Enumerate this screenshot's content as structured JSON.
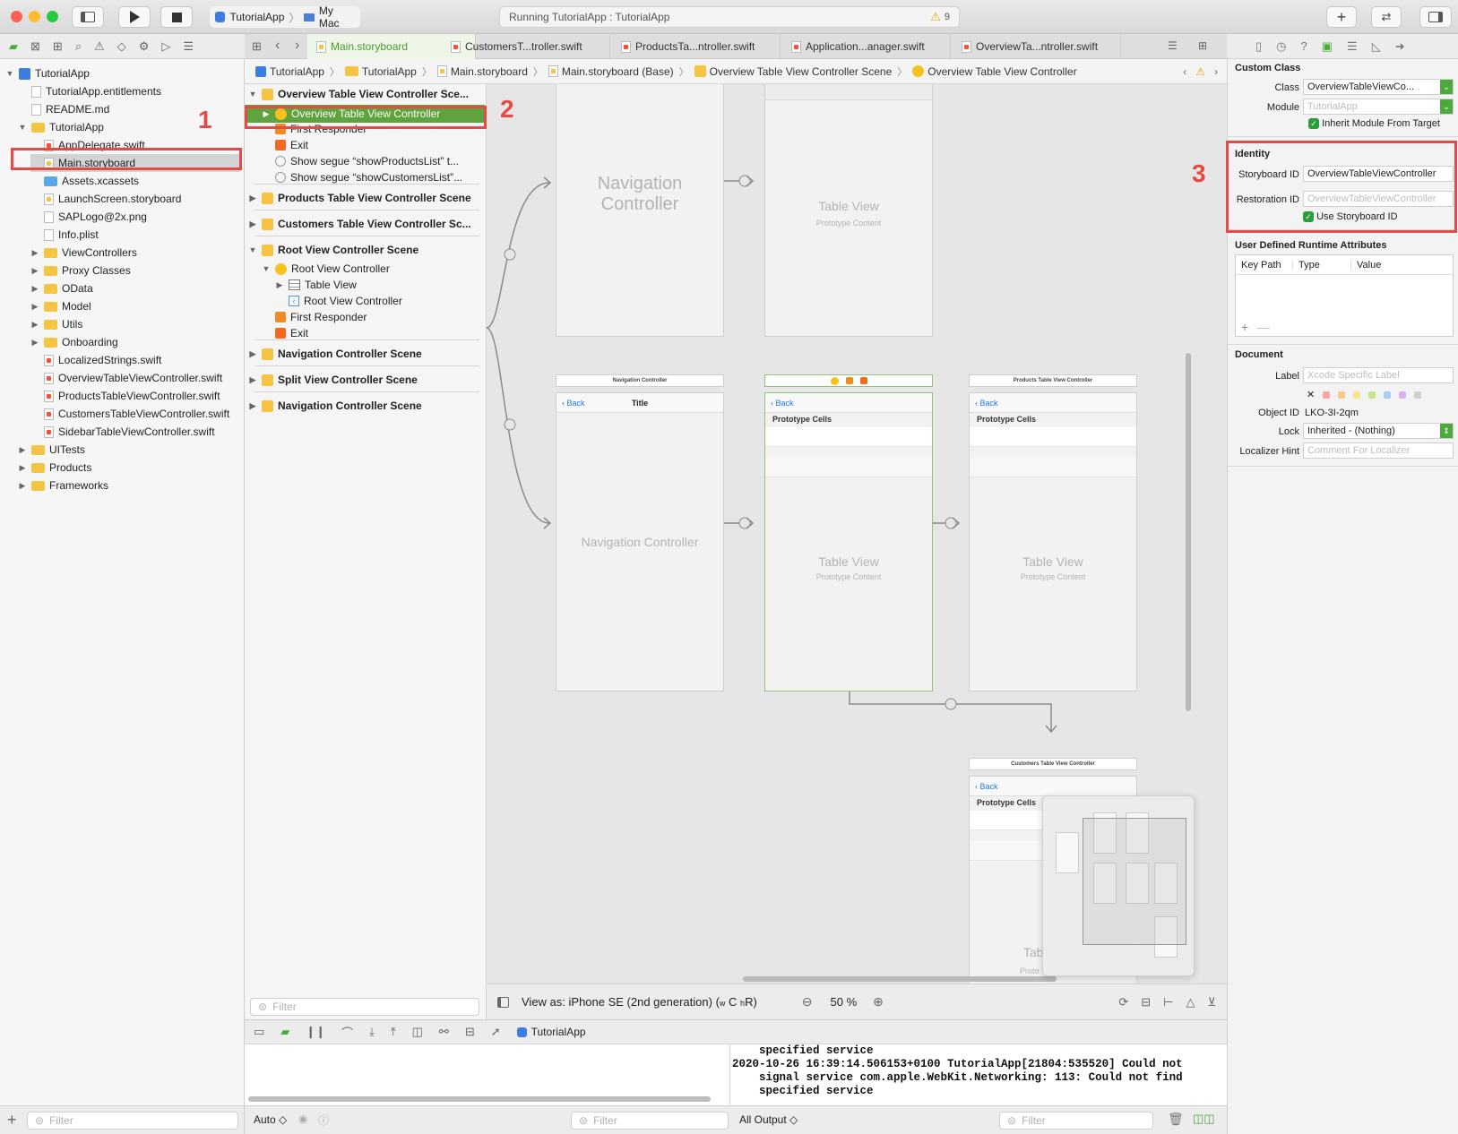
{
  "toolbar": {
    "scheme_app": "TutorialApp",
    "scheme_sep": "〉",
    "scheme_device": "My Mac",
    "status": "Running TutorialApp : TutorialApp",
    "warning_count": "9"
  },
  "navigator": {
    "items": [
      {
        "label": "TutorialApp",
        "indent": 0,
        "kind": "project",
        "disclosure": "▼"
      },
      {
        "label": "TutorialApp.entitlements",
        "indent": 1,
        "kind": "file"
      },
      {
        "label": "README.md",
        "indent": 1,
        "kind": "file"
      },
      {
        "label": "TutorialApp",
        "indent": 1,
        "kind": "folder",
        "disclosure": "▼"
      },
      {
        "label": "AppDelegate.swift",
        "indent": 2,
        "kind": "swift"
      },
      {
        "label": "Main.storyboard",
        "indent": 2,
        "kind": "storyboard",
        "selected": true
      },
      {
        "label": "Assets.xcassets",
        "indent": 2,
        "kind": "assets"
      },
      {
        "label": "LaunchScreen.storyboard",
        "indent": 2,
        "kind": "storyboard"
      },
      {
        "label": "SAPLogo@2x.png",
        "indent": 2,
        "kind": "file"
      },
      {
        "label": "Info.plist",
        "indent": 2,
        "kind": "file"
      },
      {
        "label": "ViewControllers",
        "indent": 2,
        "kind": "folder",
        "disclosure": "▶"
      },
      {
        "label": "Proxy Classes",
        "indent": 2,
        "kind": "folder",
        "disclosure": "▶"
      },
      {
        "label": "OData",
        "indent": 2,
        "kind": "folder",
        "disclosure": "▶"
      },
      {
        "label": "Model",
        "indent": 2,
        "kind": "folder",
        "disclosure": "▶"
      },
      {
        "label": "Utils",
        "indent": 2,
        "kind": "folder",
        "disclosure": "▶"
      },
      {
        "label": "Onboarding",
        "indent": 2,
        "kind": "folder",
        "disclosure": "▶"
      },
      {
        "label": "LocalizedStrings.swift",
        "indent": 2,
        "kind": "swift"
      },
      {
        "label": "OverviewTableViewController.swift",
        "indent": 2,
        "kind": "swift"
      },
      {
        "label": "ProductsTableViewController.swift",
        "indent": 2,
        "kind": "swift"
      },
      {
        "label": "CustomersTableViewController.swift",
        "indent": 2,
        "kind": "swift"
      },
      {
        "label": "SidebarTableViewController.swift",
        "indent": 2,
        "kind": "swift"
      },
      {
        "label": "UITests",
        "indent": 1,
        "kind": "folder",
        "disclosure": "▶"
      },
      {
        "label": "Products",
        "indent": 1,
        "kind": "folder",
        "disclosure": "▶"
      },
      {
        "label": "Frameworks",
        "indent": 1,
        "kind": "folder",
        "disclosure": "▶"
      }
    ],
    "filter_placeholder": "Filter"
  },
  "tabs": [
    {
      "label": "Main.storyboard",
      "active": true
    },
    {
      "label": "CustomersT...troller.swift"
    },
    {
      "label": "ProductsTa...ntroller.swift"
    },
    {
      "label": "Application...anager.swift"
    },
    {
      "label": "OverviewTa...ntroller.swift"
    }
  ],
  "breadcrumbs": [
    "TutorialApp",
    "TutorialApp",
    "Main.storyboard",
    "Main.storyboard (Base)",
    "Overview Table View Controller Scene",
    "Overview Table View Controller"
  ],
  "outline": {
    "rows": [
      {
        "label": "Overview Table View Controller Sce...",
        "indent": 0,
        "icon": "scene",
        "disclosure": "▼",
        "header": true
      },
      {
        "label": "Overview Table View Controller",
        "indent": 1,
        "icon": "vc",
        "disclosure": "▶",
        "selected": true
      },
      {
        "label": "First Responder",
        "indent": 1,
        "icon": "responder"
      },
      {
        "label": "Exit",
        "indent": 1,
        "icon": "exit"
      },
      {
        "label": "Show segue “showProductsList” t...",
        "indent": 1,
        "icon": "segue"
      },
      {
        "label": "Show segue “showCustomersList”...",
        "indent": 1,
        "icon": "segue"
      },
      {
        "label": "Products Table View Controller Scene",
        "indent": 0,
        "icon": "scene",
        "disclosure": "▶",
        "header": true
      },
      {
        "label": "Customers Table View Controller Sc...",
        "indent": 0,
        "icon": "scene",
        "disclosure": "▶",
        "header": true
      },
      {
        "label": "Root View Controller Scene",
        "indent": 0,
        "icon": "scene",
        "disclosure": "▼",
        "header": true
      },
      {
        "label": "Root View Controller",
        "indent": 1,
        "icon": "vc",
        "disclosure": "▼"
      },
      {
        "label": "Table View",
        "indent": 2,
        "icon": "table",
        "disclosure": "▶"
      },
      {
        "label": "Root View Controller",
        "indent": 2,
        "icon": "nav"
      },
      {
        "label": "First Responder",
        "indent": 1,
        "icon": "responder"
      },
      {
        "label": "Exit",
        "indent": 1,
        "icon": "exit"
      },
      {
        "label": "Navigation Controller Scene",
        "indent": 0,
        "icon": "scene",
        "disclosure": "▶",
        "header": true
      },
      {
        "label": "Split View Controller Scene",
        "indent": 0,
        "icon": "scene",
        "disclosure": "▶",
        "header": true
      },
      {
        "label": "Navigation Controller Scene",
        "indent": 0,
        "icon": "scene",
        "disclosure": "▶",
        "header": true
      }
    ],
    "filter_placeholder": "Filter"
  },
  "canvas": {
    "nav_controller_label": "Navigation Controller",
    "table_view_label": "Table View",
    "prototype_content": "Prototype Content",
    "prototype_cells": "Prototype Cells",
    "back": "Back",
    "title": "Title",
    "nav_header": "Navigation Controller",
    "products_header": "Products Table View Controller",
    "customers_header": "Customers Table View Controller",
    "partial_table": "Tab",
    "partial_proto": "Proto"
  },
  "canvas_bar": {
    "view_as": "View as: iPhone SE (2nd generation) (",
    "size_class_w": "w",
    "size_class_w_val": "C",
    "size_class_h": "h",
    "size_class_h_val": "R)",
    "zoom": "50 %"
  },
  "debug": {
    "target": "TutorialApp",
    "console_text": "    specified service\n2020-10-26 16:39:14.506153+0100 TutorialApp[21804:535520] Could not\n    signal service com.apple.WebKit.Networking: 113: Could not find\n    specified service",
    "auto_label": "Auto ◇",
    "output_label": "All Output ◇",
    "filter_placeholder": "Filter"
  },
  "inspector": {
    "custom_class_title": "Custom Class",
    "class_label": "Class",
    "class_value": "OverviewTableViewCo...",
    "module_label": "Module",
    "module_value": "TutorialApp",
    "inherit_label": "Inherit Module From Target",
    "identity_title": "Identity",
    "storyboard_id_label": "Storyboard ID",
    "storyboard_id_value": "OverviewTableViewController",
    "restoration_id_label": "Restoration ID",
    "restoration_id_value": "OverviewTableViewController",
    "use_storyboard_id_label": "Use Storyboard ID",
    "udra_title": "User Defined Runtime Attributes",
    "col_key_path": "Key Path",
    "col_type": "Type",
    "col_value": "Value",
    "document_title": "Document",
    "doc_label_label": "Label",
    "doc_label_placeholder": "Xcode Specific Label",
    "object_id_label": "Object ID",
    "object_id_value": "LKO-3I-2qm",
    "lock_label": "Lock",
    "lock_value": "Inherited - (Nothing)",
    "localizer_label": "Localizer Hint",
    "localizer_placeholder": "Comment For Localizer"
  },
  "annotations": {
    "one": "1",
    "two": "2",
    "three": "3"
  },
  "colors": {
    "accent_green": "#5ea33b",
    "highlight_red": "#e34b44",
    "folder_yellow": "#f5c443"
  }
}
